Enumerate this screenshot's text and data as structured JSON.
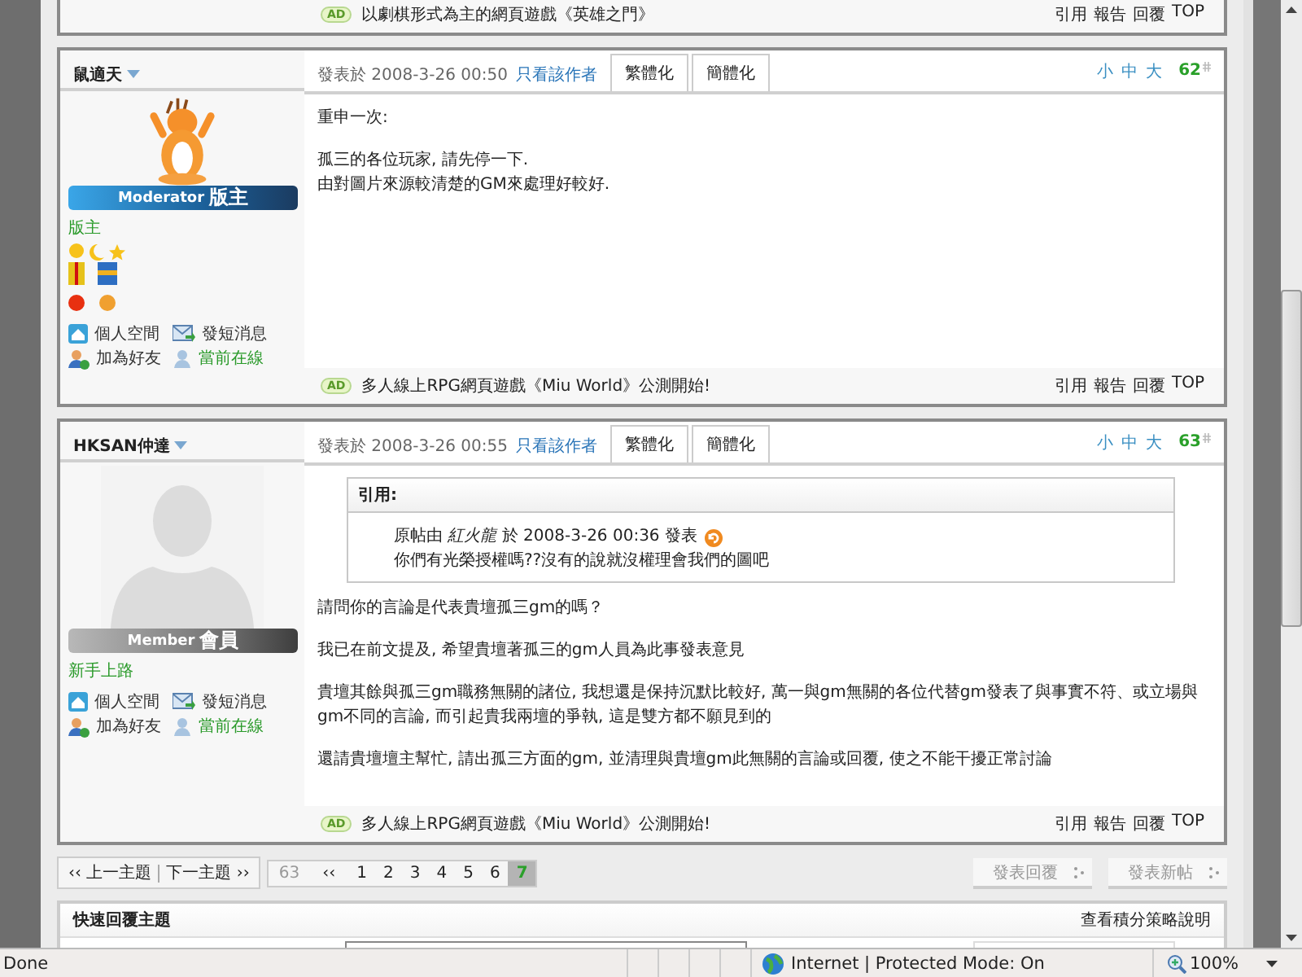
{
  "previous_post": {
    "ad_badge": "AD",
    "ad": "以劇棋形式為主的網頁遊戲《英雄之門》",
    "actions": [
      "引用",
      "報告",
      "回覆",
      "TOP"
    ]
  },
  "posts": [
    {
      "author": "鼠適天",
      "avatar": {
        "kind": "character"
      },
      "badge": {
        "kind": "moderator",
        "en": "Moderator",
        "zh": "版主"
      },
      "group": "版主",
      "links": [
        {
          "kind": "home",
          "label": "個人空間"
        },
        {
          "kind": "mail",
          "label": "發短消息"
        },
        {
          "kind": "friend",
          "label": "加為好友"
        },
        {
          "kind": "online",
          "label": "當前在線"
        }
      ],
      "posted": "發表於 2008-3-26 00:50",
      "author_only": "只看該作者",
      "tabs": [
        "繁體化",
        "簡體化"
      ],
      "sizes": [
        "小",
        "中",
        "大"
      ],
      "floor": "62",
      "paragraphs": [
        [
          "重申一次:"
        ],
        [
          "孤三的各位玩家, 請先停一下.",
          "由對圖片來源較清楚的GM來處理好較好."
        ]
      ],
      "ad_badge": "AD",
      "ad": "多人線上RPG網頁遊戲《Miu World》公測開始!",
      "actions": [
        "引用",
        "報告",
        "回覆",
        "TOP"
      ]
    },
    {
      "author": "HKSAN仲達",
      "avatar": {
        "kind": "silhouette"
      },
      "badge": {
        "kind": "member",
        "en": "Member",
        "zh": "會員"
      },
      "group": "新手上路",
      "links": [
        {
          "kind": "home",
          "label": "個人空間"
        },
        {
          "kind": "mail",
          "label": "發短消息"
        },
        {
          "kind": "friend",
          "label": "加為好友"
        },
        {
          "kind": "online",
          "label": "當前在線"
        }
      ],
      "posted": "發表於 2008-3-26 00:55",
      "author_only": "只看該作者",
      "tabs": [
        "繁體化",
        "簡體化"
      ],
      "sizes": [
        "小",
        "中",
        "大"
      ],
      "floor": "63",
      "quote": {
        "title": "引用:",
        "byline": "原帖由 *紅火龍* 於 2008-3-26 00:36 發表",
        "text": "你們有光榮授權嗎??沒有的說就沒權理會我們的圖吧"
      },
      "paragraphs": [
        [
          "請問你的言論是代表貴壇孤三gm的嗎？"
        ],
        [
          "我已在前文提及, 希望貴壇著孤三的gm人員為此事發表意見"
        ],
        [
          "貴壇其餘與孤三gm職務無關的諸位, 我想還是保持沉默比較好, 萬一與gm無關的各位代替gm發表了與事實不符、或立場與gm不同的言論, 而引起貴我兩壇的爭執, 這是雙方都不願見到的"
        ],
        [
          "還請貴壇壇主幫忙, 請出孤三方面的gm, 並清理與貴壇gm此無關的言論或回覆, 使之不能干擾正常討論"
        ]
      ],
      "ad_badge": "AD",
      "ad": "多人線上RPG網頁遊戲《Miu World》公測開始!",
      "actions": [
        "引用",
        "報告",
        "回覆",
        "TOP"
      ]
    }
  ],
  "thread_nav": {
    "prev": "‹‹ 上一主題",
    "next": "下一主題 ››"
  },
  "pages": [
    {
      "label": "63",
      "kind": "total",
      "selected": false
    },
    {
      "label": "‹‹",
      "kind": "first",
      "selected": false
    },
    {
      "label": "1",
      "kind": "page",
      "selected": false
    },
    {
      "label": "2",
      "kind": "page",
      "selected": false
    },
    {
      "label": "3",
      "kind": "page",
      "selected": false
    },
    {
      "label": "4",
      "kind": "page",
      "selected": false
    },
    {
      "label": "5",
      "kind": "page",
      "selected": false
    },
    {
      "label": "6",
      "kind": "page",
      "selected": false
    },
    {
      "label": "7",
      "kind": "page",
      "selected": true
    }
  ],
  "post_buttons": [
    "發表回覆",
    "發表新帖"
  ],
  "quick_reply": {
    "title": "快速回覆主題",
    "help_link": "查看積分策略說明"
  },
  "status_bar": {
    "text": "Done",
    "zone": "Internet | Protected Mode: On",
    "zoom": "100%"
  }
}
